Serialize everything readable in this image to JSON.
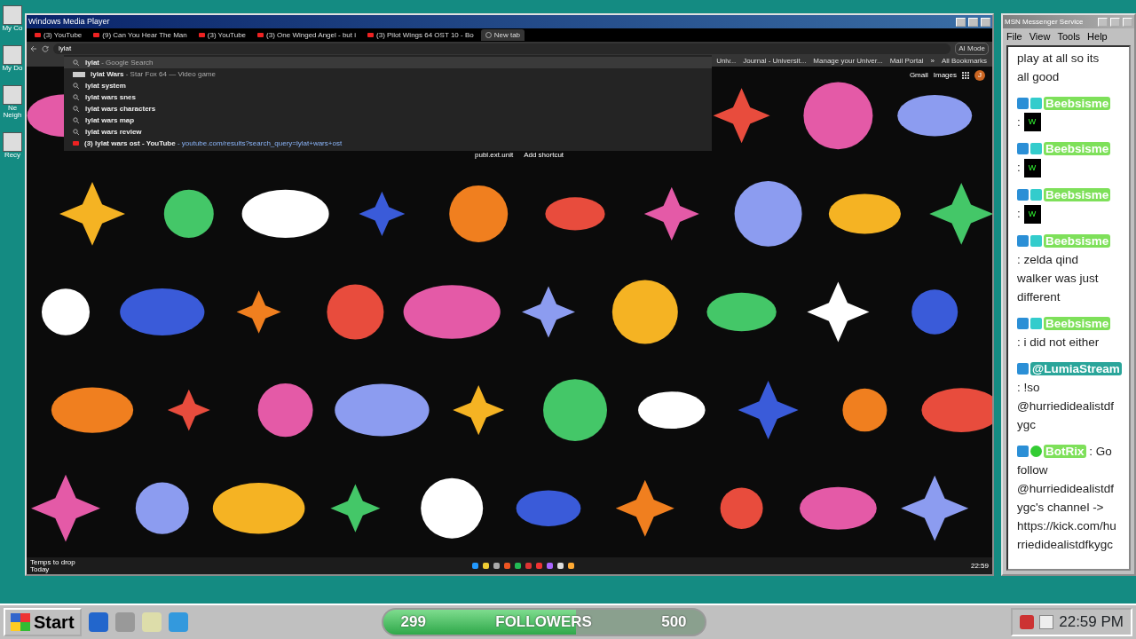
{
  "desktop_icons": [
    {
      "label": "My Co"
    },
    {
      "label": "My Do"
    },
    {
      "label": "Ne Neigh"
    },
    {
      "label": "Recy"
    }
  ],
  "player_window": {
    "title": "Windows Media Player",
    "browser": {
      "tabs": [
        {
          "label": "(3) YouTube",
          "selected": false
        },
        {
          "label": "(9) Can You Hear The Man",
          "selected": false
        },
        {
          "label": "(3) YouTube",
          "selected": false
        },
        {
          "label": "(3) One Winged Angel - but i",
          "selected": false
        },
        {
          "label": "(3) Pilot Wings 64 OST 10 - Bo",
          "selected": false
        },
        {
          "label": "New tab",
          "selected": true
        }
      ],
      "omnibox": {
        "value": "lylat"
      },
      "suggestions": [
        {
          "kind": "search",
          "text": "lylat",
          "detail": "- Google Search",
          "selected": true
        },
        {
          "kind": "entity",
          "text": "lylat Wars",
          "detail": "- Star Fox 64 — Video game",
          "selected": false
        },
        {
          "kind": "search",
          "text": "lylat system",
          "selected": false
        },
        {
          "kind": "search",
          "text": "lylat wars snes",
          "selected": false
        },
        {
          "kind": "search",
          "text": "lylat wars characters",
          "selected": false
        },
        {
          "kind": "search",
          "text": "lylat wars map",
          "selected": false
        },
        {
          "kind": "search",
          "text": "lylat wars review",
          "selected": false
        },
        {
          "kind": "video",
          "text": "(3) lylat wars ost - YouTube",
          "detail": "- youtube.com/results?search_query=lylat+wars+ost",
          "selected": false
        }
      ],
      "ai_mode": "AI Mode",
      "bookmarks": [
        "Univ...",
        "Journal - Universit...",
        "Manage your Univer...",
        "Mail Portal",
        "»",
        "All Bookmarks"
      ],
      "google_links": [
        "Gmail",
        "Images"
      ],
      "avatar_letter": "J",
      "shortcuts": [
        "publ.ext.unit",
        "Add shortcut"
      ],
      "inner_taskbar": {
        "weather": "Temps to drop",
        "weather_sub": "Today",
        "time": "22:59"
      }
    }
  },
  "messenger": {
    "title": "MSN Messenger Service",
    "menu": [
      "File",
      "View",
      "Tools",
      "Help"
    ],
    "messages": [
      {
        "kind": "continuation",
        "lines": [
          "play at all so its",
          "all good"
        ]
      },
      {
        "kind": "chat",
        "user": "Beebsisme",
        "color": "#7ee05a",
        "moderator": true,
        "subscriber": true,
        "lines": [
          ":"
        ],
        "emote": "W"
      },
      {
        "kind": "chat",
        "user": "Beebsisme",
        "color": "#7ee05a",
        "moderator": true,
        "subscriber": true,
        "lines": [
          ":"
        ],
        "emote": "W"
      },
      {
        "kind": "chat",
        "user": "Beebsisme",
        "color": "#7ee05a",
        "moderator": true,
        "subscriber": true,
        "lines": [
          ":"
        ],
        "emote": "W"
      },
      {
        "kind": "chat",
        "user": "Beebsisme",
        "color": "#7ee05a",
        "moderator": true,
        "subscriber": true,
        "lines": [
          ": zelda qind",
          "walker was just",
          "different"
        ]
      },
      {
        "kind": "chat",
        "user": "Beebsisme",
        "color": "#7ee05a",
        "moderator": true,
        "subscriber": true,
        "lines": [
          ": i did not either"
        ]
      },
      {
        "kind": "chat",
        "user": "@LumiaStream",
        "color": "#2aa59a",
        "moderator": true,
        "lines": [
          ": !so",
          "@hurriedidealistdf",
          "ygc"
        ]
      },
      {
        "kind": "chat",
        "user": "BotRix",
        "color": "#7ee05a",
        "moderator": true,
        "verified": true,
        "inline": ": Go",
        "lines": [
          "follow",
          "@hurriedidealistdf",
          "ygc's channel ->",
          "https://kick.com/hu",
          "rriedidealistdfkygc"
        ]
      }
    ]
  },
  "taskbar": {
    "start": "Start",
    "followers": {
      "current": "299",
      "label": "FOLLOWERS",
      "goal": "500",
      "level": 0.6
    },
    "clock": "22:59 PM"
  }
}
